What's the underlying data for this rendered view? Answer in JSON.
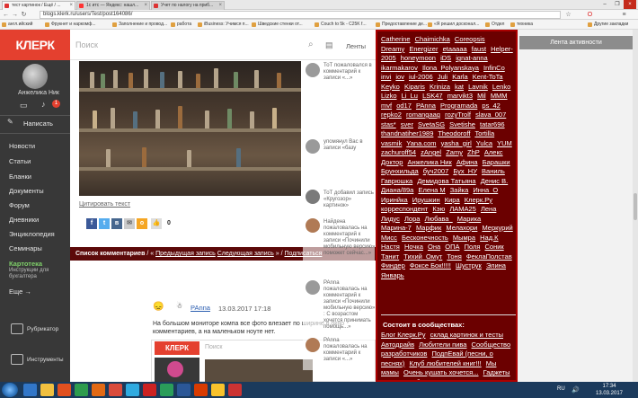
{
  "browser": {
    "tabs": [
      {
        "label": "тест картинок / Ещё / ..."
      },
      {
        "label": "1с итс — Яндекс: нашл..."
      },
      {
        "label": "Учет по налогу на приб..."
      }
    ],
    "url": "blogs.klerk.ru/users/Test/post164086/",
    "bookmarks": [
      "англ.ийский",
      "Фрукнет и наркомф...",
      "Заполнение и провод...",
      "работа",
      "iBusiness: Учимся п...",
      "Шведские стенки от...",
      "Couch to 5k - C25K f...",
      "Предоставление де...",
      "«Я решил досконал...",
      "Отдел",
      "техника",
      "Другие закладки"
    ]
  },
  "sidebar": {
    "logo": "КЛЕРК",
    "user_name": "Анжелика Ник",
    "notifications_count": "1",
    "write_label": "Написать",
    "nav": [
      "Новости",
      "Статьи",
      "Бланки",
      "Документы",
      "Форум",
      "Дневники",
      "Энциклопедия",
      "Семинары"
    ],
    "kartoteka_title": "Картотека",
    "kartoteka_sub": "Инструкции для бухгалтера",
    "more": "Еще →",
    "rubricator": "Рубрикатор",
    "tools": "Инструменты"
  },
  "topbar": {
    "search_placeholder": "Поиск",
    "feeds_label": "Ленты",
    "activity_header": "Лента активности"
  },
  "post": {
    "image_caption": "Цитировать текст",
    "share_count": "0",
    "comments_bar": {
      "label": "Список комментариев",
      "prev": "Предыдущая запись",
      "next": "Следующая запись",
      "subscribe": "Подписаться"
    },
    "comment": {
      "author": "PAnna",
      "date": "13.03.2017 17:18",
      "text": "На большом мониторе компа все фото влезает по ширине в окно комментариев, а на маленьком ноуте нет."
    },
    "embed": {
      "logo": "КЛЕРК",
      "search": "Поиск"
    }
  },
  "feed": {
    "items": [
      "ТоТ пожаловался в комментарий к записи «...»",
      "упомянул Вас в записи «базу",
      "ТоТ добавил запись «Кругозор» картинок»",
      "Найдена пожаловалась на комментарий к записи «Починили мобильную версию» поможет сейчас...»",
      "PAnna пожаловалась на комментарий к записи «Починили мобильную версию» : С возрастом хочется принимать помощь...»",
      "PAnna пожаловалась на комментарий к записи «...»"
    ]
  },
  "overlay": {
    "tags": [
      "Catherine",
      "Chaimichka",
      "Coreopsis",
      "Dreamy",
      "Energizer",
      "etaaaaa",
      "faust",
      "Helper-2005",
      "honeymoon",
      "iDS",
      "ignat-anna",
      "ikarmakarov",
      "Ilona_Polyanskaya",
      "InfinCo",
      "invi",
      "iov",
      "iul-2006",
      "Juli",
      "Karla",
      "Kent-ToTa",
      "Keyko",
      "Kiparis",
      "Kriniza",
      "kat",
      "Lavnik",
      "Lenko",
      "Lizko",
      "Li_Lu",
      "LSK47",
      "marvikt3",
      "Mil",
      "MMM",
      "mvf",
      "od17",
      "PAnna",
      "Programada",
      "ps_42",
      "repko2",
      "romangaag",
      "rozyTrolf",
      "slava_007",
      "stas*",
      "sver",
      "SvetaSG",
      "Svetishe",
      "tatar696",
      "thandnatiher1989",
      "Theodoroff",
      "Tortilla",
      "vasmik",
      "Yana.com",
      "yasha_girl",
      "Yulca",
      "YUM",
      "zachuroff54",
      "zAngel",
      "Zamy",
      "ZhP",
      "Алекс",
      "Доктор",
      "Анжелика Ник",
      "Афина",
      "Барашки",
      "Брунхильда",
      "буч2007",
      "Бух_НУ",
      "Ваниль",
      "Гаврюшка",
      "Демидова Татьяна",
      "Денис В.",
      "Диана/89а",
      "Елена М",
      "Зайка",
      "Инна_О",
      "Иринйка",
      "Ирушкин",
      "Кира",
      "Клерк.Ру",
      "корреспондент",
      "Кэю",
      "ЛАМА25",
      "Лена",
      "Лидус",
      "Лора",
      "Любава_",
      "Марика",
      "Марина-7",
      "Марфик",
      "Мелахори",
      "Меркурий",
      "Мисс",
      "Бесконечность",
      "Мымра",
      "Над.К",
      "Настя",
      "Ночка",
      "Она",
      "ОПА",
      "Поля",
      "Соник",
      "Танит",
      "Тихий_Омут",
      "Тоня",
      "ФеклаПолстав",
      "Финдер",
      "Фоксе Бок!!!!!",
      "Шуструк",
      "Элина",
      "Январь"
    ],
    "communities_title": "Состоит в сообществах:",
    "communities": [
      "Блог Клерк.Ру",
      "склад картинок и тесты",
      "Автодрайв",
      "Любители пива",
      "Сообщество разработчиков",
      "ПодпЕвай (песни, о песнях)",
      "Клуб любителей книг!!!",
      "Мы мамы",
      "Очень кушать хочется...",
      "Гаджеты для нас любимых...",
      "Клерк.Ру: Хроника встреч",
      "Интересные ссылки",
      "14 июня",
      "Пошли в кино!",
      "Встречи Клерка",
      "Архитектура и памятники",
      "Стихи"
    ]
  },
  "taskbar": {
    "time": "17:34",
    "date": "13.03.2017",
    "lang": "RU"
  }
}
